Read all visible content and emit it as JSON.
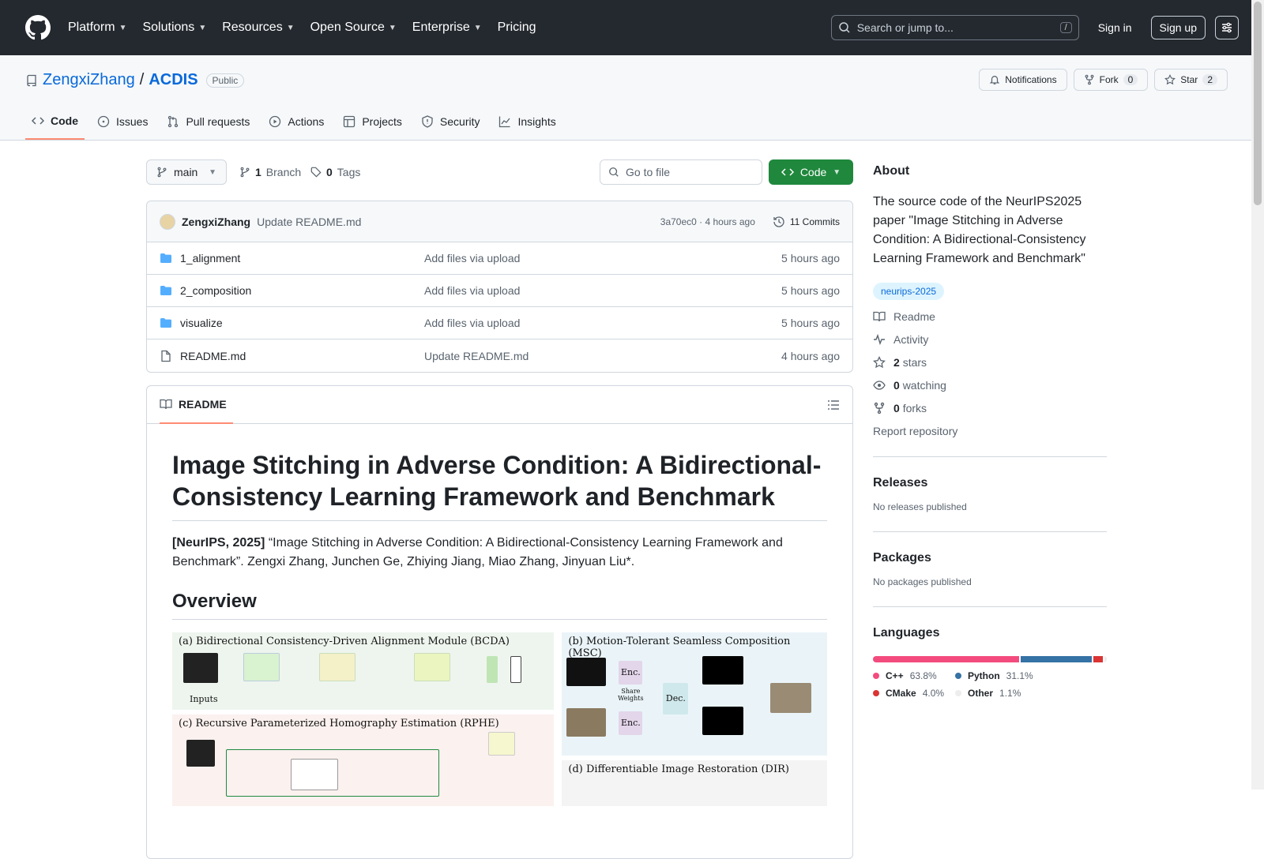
{
  "nav": {
    "items": [
      "Platform",
      "Solutions",
      "Resources",
      "Open Source",
      "Enterprise",
      "Pricing"
    ],
    "search_placeholder": "Search or jump to...",
    "slash_key": "/",
    "sign_in": "Sign in",
    "sign_up": "Sign up"
  },
  "repo": {
    "owner": "ZengxiZhang",
    "sep": "/",
    "name": "ACDIS",
    "visibility": "Public",
    "notifications": "Notifications",
    "fork_label": "Fork",
    "fork_count": "0",
    "star_label": "Star",
    "star_count": "2"
  },
  "tabs": [
    "Code",
    "Issues",
    "Pull requests",
    "Actions",
    "Projects",
    "Security",
    "Insights"
  ],
  "branch": {
    "name": "main",
    "branch_count": "1",
    "branch_label": "Branch",
    "tag_count": "0",
    "tag_label": "Tags",
    "go_to_file": "Go to file",
    "code_button": "Code"
  },
  "commit": {
    "user": "ZengxiZhang",
    "message": "Update README.md",
    "meta": "3a70ec0 · 4 hours ago",
    "commits": "11 Commits"
  },
  "files": [
    {
      "name": "1_alignment",
      "type": "folder",
      "message": "Add files via upload",
      "time": "5 hours ago"
    },
    {
      "name": "2_composition",
      "type": "folder",
      "message": "Add files via upload",
      "time": "5 hours ago"
    },
    {
      "name": "visualize",
      "type": "folder",
      "message": "Add files via upload",
      "time": "5 hours ago"
    },
    {
      "name": "README.md",
      "type": "file",
      "message": "Update README.md",
      "time": "4 hours ago"
    }
  ],
  "readme": {
    "tab": "README",
    "title": "Image Stitching in Adverse Condition: A Bidirectional-Consistency Learning Framework and Benchmark",
    "cite_bold": "[NeurIPS, 2025]",
    "cite_text": " “Image Stitching in Adverse Condition: A Bidirectional-Consistency Learning Framework and Benchmark”. Zengxi Zhang, Junchen Ge, Zhiying Jiang, Miao Zhang, Jinyuan Liu*.",
    "overview": "Overview",
    "fig_a": "(a) Bidirectional Consistency-Driven Alignment Module  (BCDA)",
    "fig_b": "(b) Motion-Tolerant  Seamless Composition (MSC)",
    "fig_c": "(c)  Recursive Parameterized Homography Estimation  (RPHE)",
    "fig_d": "(d)  Differentiable Image Restoration (DIR)",
    "fig_inputs": "Inputs",
    "fig_enc": "Enc.",
    "fig_dec": "Dec.",
    "fig_share": "Share Weights"
  },
  "about": {
    "heading": "About",
    "description": "The source code of the NeurIPS2025 paper \"Image Stitching in Adverse Condition: A Bidirectional-Consistency Learning Framework and Benchmark\"",
    "topic": "neurips-2025",
    "readme": "Readme",
    "activity": "Activity",
    "stars_count": "2",
    "stars_label": "stars",
    "watching_count": "0",
    "watching_label": "watching",
    "forks_count": "0",
    "forks_label": "forks",
    "report": "Report repository"
  },
  "releases": {
    "heading": "Releases",
    "empty": "No releases published"
  },
  "packages": {
    "heading": "Packages",
    "empty": "No packages published"
  },
  "languages": {
    "heading": "Languages",
    "items": [
      {
        "name": "C++",
        "percent": "63.8%",
        "value": 63.8,
        "color": "#f34b7d"
      },
      {
        "name": "Python",
        "percent": "31.1%",
        "value": 31.1,
        "color": "#3572A5"
      },
      {
        "name": "CMake",
        "percent": "4.0%",
        "value": 4.0,
        "color": "#DA3434"
      },
      {
        "name": "Other",
        "percent": "1.1%",
        "value": 1.1,
        "color": "#ededed"
      }
    ]
  }
}
